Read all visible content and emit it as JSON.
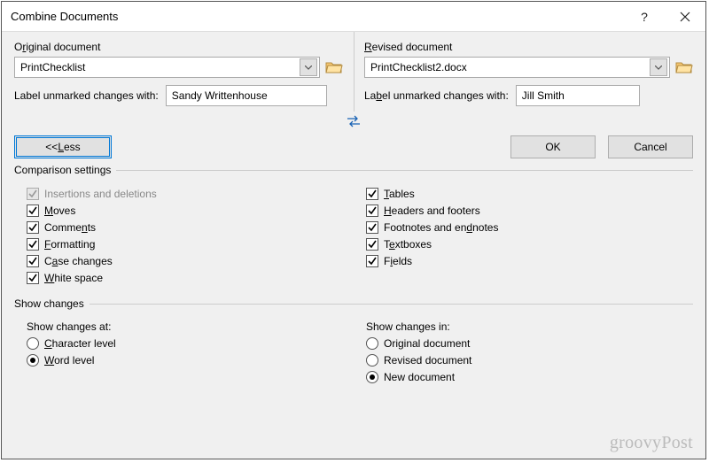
{
  "title": "Combine Documents",
  "original": {
    "label_pre": "O",
    "label_u": "r",
    "label_post": "iginal document",
    "value": "PrintChecklist",
    "label_unmarked": "Label unmarked changes with:",
    "author": "Sandy Writtenhouse"
  },
  "revised": {
    "label_u": "R",
    "label_post": "evised document",
    "value": "PrintChecklist2.docx",
    "label_u2": "b",
    "label_unmarked_pre": "La",
    "label_unmarked_post": "el unmarked changes with:",
    "author": "Jill Smith"
  },
  "buttons": {
    "less_pre": "<< ",
    "less_u": "L",
    "less_post": "ess",
    "ok": "OK",
    "cancel": "Cancel"
  },
  "groups": {
    "comparison": "Comparison settings",
    "show_changes": "Show changes"
  },
  "settings": {
    "insertions": "Insertions and deletions",
    "moves_u": "M",
    "moves_post": "oves",
    "comments_pre": "Comme",
    "comments_u": "n",
    "comments_post": "ts",
    "formatting_u": "F",
    "formatting_post": "ormatting",
    "case_pre": "C",
    "case_u": "a",
    "case_post": "se changes",
    "white_u": "W",
    "white_post": "hite space",
    "tables_u": "T",
    "tables_post": "ables",
    "headers_u": "H",
    "headers_post": "eaders and footers",
    "footnotes_pre": "Footnotes and en",
    "footnotes_u": "d",
    "footnotes_post": "notes",
    "textboxes_pre": "T",
    "textboxes_u": "e",
    "textboxes_post": "xtboxes",
    "fields_pre": "F",
    "fields_u": "i",
    "fields_post": "elds"
  },
  "show_at": {
    "label": "Show changes at:",
    "char_u": "C",
    "char_post": "haracter level",
    "word_u": "W",
    "word_post": "ord level"
  },
  "show_in": {
    "label": "Show changes in:",
    "original": "Original document",
    "revised": "Revised document",
    "new": "New document"
  },
  "watermark": "groovyPost"
}
